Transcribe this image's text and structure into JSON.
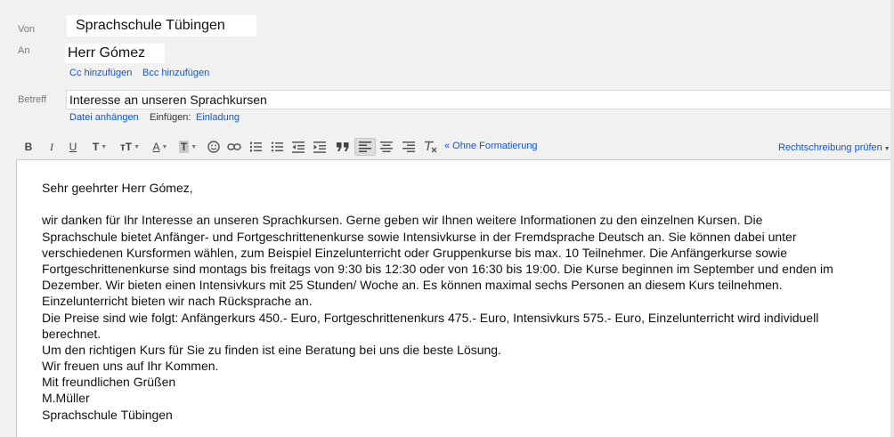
{
  "header": {
    "from_label": "Von",
    "from_value": "Sprachschule Tübingen",
    "to_label": "An",
    "to_value": "Herr Gómez",
    "cc_link": "Cc hinzufügen",
    "bcc_link": "Bcc hinzufügen",
    "subject_label": "Betreff",
    "subject_value": "Interesse an unseren Sprachkursen",
    "attach_link": "Datei anhängen",
    "insert_label": "Einfügen:",
    "invitation_link": "Einladung"
  },
  "toolbar": {
    "bold": "B",
    "italic": "I",
    "underline": "U",
    "font": "T",
    "size": "тT",
    "text_color": "A",
    "highlight": "T",
    "remove_format_link": "« Ohne Formatierung",
    "spellcheck": "Rechtschreibung prüfen",
    "active_button": "align-left",
    "icons": [
      "bold-icon",
      "italic-icon",
      "underline-icon",
      "font-icon",
      "font-size-icon",
      "text-color-icon",
      "highlight-color-icon",
      "smiley-icon",
      "link-icon",
      "numbered-list-icon",
      "bulleted-list-icon",
      "indent-less-icon",
      "indent-more-icon",
      "quote-icon",
      "align-left-icon",
      "align-center-icon",
      "align-right-icon",
      "clear-format-icon"
    ]
  },
  "body": {
    "greeting": "Sehr geehrter Herr Gómez,",
    "lines": [
      "wir danken für Ihr Interesse an unseren Sprachkursen. Gerne geben wir Ihnen weitere Informationen zu den einzelnen Kursen. Die",
      "Sprachschule bietet Anfänger- und Fortgeschrittenenkurse sowie Intensivkurse in der Fremdsprache Deutsch an. Sie können dabei unter",
      "verschiedenen Kursformen wählen, zum Beispiel Einzelunterricht oder Gruppenkurse bis max. 10 Teilnehmer. Die Anfängerkurse sowie",
      "Fortgeschrittenenkurse sind montags bis freitags von 9:30 bis 12:30 oder von 16:30 bis 19:00. Die Kurse beginnen im September und enden im",
      "Dezember. Wir bieten einen Intensivkurs mit 25 Stunden/ Woche an. Es können maximal sechs Personen an diesem Kurs teilnehmen.",
      "Einzelunterricht bieten wir nach Rücksprache an.",
      "Die Preise sind wie folgt: Anfängerkurs  450.- Euro, Fortgeschrittenenkurs 475.- Euro, Intensivkurs 575.- Euro, Einzelunterricht wird individuell",
      "berechnet.",
      "Um den richtigen Kurs für Sie zu finden ist eine Beratung bei uns die beste Lösung.",
      "Wir freuen uns auf Ihr Kommen.",
      "Mit freundlichen Grüßen",
      "M.Müller",
      "Sprachschule Tübingen"
    ]
  }
}
